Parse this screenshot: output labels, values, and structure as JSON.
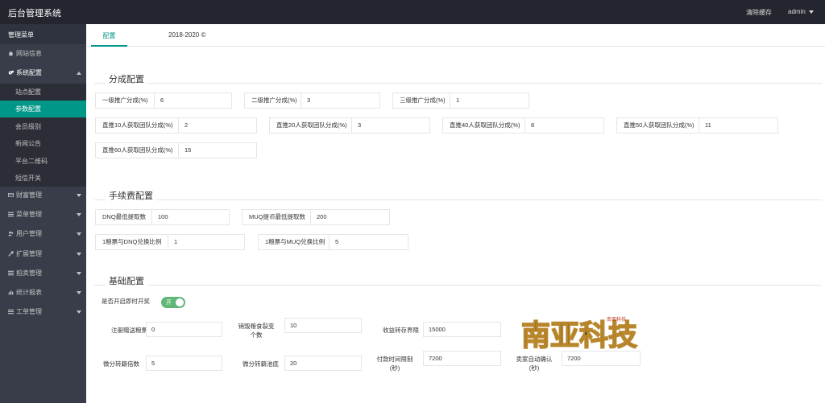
{
  "app": {
    "title": "后台管理系统",
    "clear_cache": "清除缓存",
    "user": "admin"
  },
  "sidebar": {
    "header": "管理菜单",
    "items": [
      {
        "label": "网站信息",
        "icon": "home-icon"
      },
      {
        "label": "系统配置",
        "icon": "gears-icon",
        "expanded": true
      },
      {
        "label": "财富管理",
        "icon": "card-icon"
      },
      {
        "label": "菜单管理",
        "icon": "list-icon"
      },
      {
        "label": "用户管理",
        "icon": "users-icon"
      },
      {
        "label": "扩展管理",
        "icon": "wrench-icon"
      },
      {
        "label": "拍卖管理",
        "icon": "list-icon"
      },
      {
        "label": "统计报表",
        "icon": "chart-icon"
      },
      {
        "label": "工单管理",
        "icon": "list-icon"
      }
    ],
    "subitems": [
      {
        "label": "站点配置"
      },
      {
        "label": "参数配置",
        "active": true
      },
      {
        "label": "会员级别"
      },
      {
        "label": "新闻公告"
      },
      {
        "label": "平台二维码"
      },
      {
        "label": "短信开关"
      }
    ]
  },
  "tabs": {
    "active_tab": "配置",
    "copyright": "2018-2020 ©"
  },
  "sections": {
    "commission": "分成配置",
    "fee": "手续费配置",
    "basic": "基础配置"
  },
  "commission": {
    "level1": {
      "label": "一级推广分成(%)",
      "value": "6"
    },
    "level2": {
      "label": "二级推广分成(%)",
      "value": "3"
    },
    "level3": {
      "label": "三级推广分成(%)",
      "value": "1"
    },
    "team10": {
      "label": "直推10人获取团队分成(%)",
      "value": "2"
    },
    "team20": {
      "label": "直推20人获取团队分成(%)",
      "value": "3"
    },
    "team40": {
      "label": "直推40人获取团队分成(%)",
      "value": "8"
    },
    "team50": {
      "label": "直推50人获取团队分成(%)",
      "value": "11"
    },
    "team60": {
      "label": "直推60人获取团队分成(%)",
      "value": "15"
    }
  },
  "fee": {
    "dnq_min": {
      "label": "DNQ最低提取数",
      "value": "100"
    },
    "muq_min": {
      "label": "MUQ提币最低提取数",
      "value": "200"
    },
    "dnq_ratio": {
      "label": "1粮票与DNQ兑换比例",
      "value": "1"
    },
    "muq_ratio": {
      "label": "1粮票与MUQ兑换比例",
      "value": "5"
    }
  },
  "basic": {
    "instant_open": {
      "label": "是否开启即时开奖",
      "toggle_text": "开",
      "on": true
    },
    "register_gift": {
      "label": "注册赠送粮票",
      "value": "0"
    },
    "split_count": {
      "label": "销毁粮食裂变\n个数",
      "value": "10"
    },
    "income_limit": {
      "label": "收益转存界限",
      "value": "15000"
    },
    "micro_multiple": {
      "label": "微分转籍倍数",
      "value": "5"
    },
    "micro_pool": {
      "label": "微分转籍池底",
      "value": "20"
    },
    "pay_timeout": {
      "label": "付款时间限制\n(秒)",
      "value": "7200"
    },
    "seller_confirm": {
      "label": "卖家自动确认\n(秒)",
      "value": "7200"
    }
  },
  "watermark": {
    "text": "南亚科技",
    "small": "南亚科技"
  },
  "colors": {
    "accent": "#009688",
    "topbar": "#23262e",
    "sidebar": "#393d49",
    "toggle_on": "#5fb878"
  }
}
